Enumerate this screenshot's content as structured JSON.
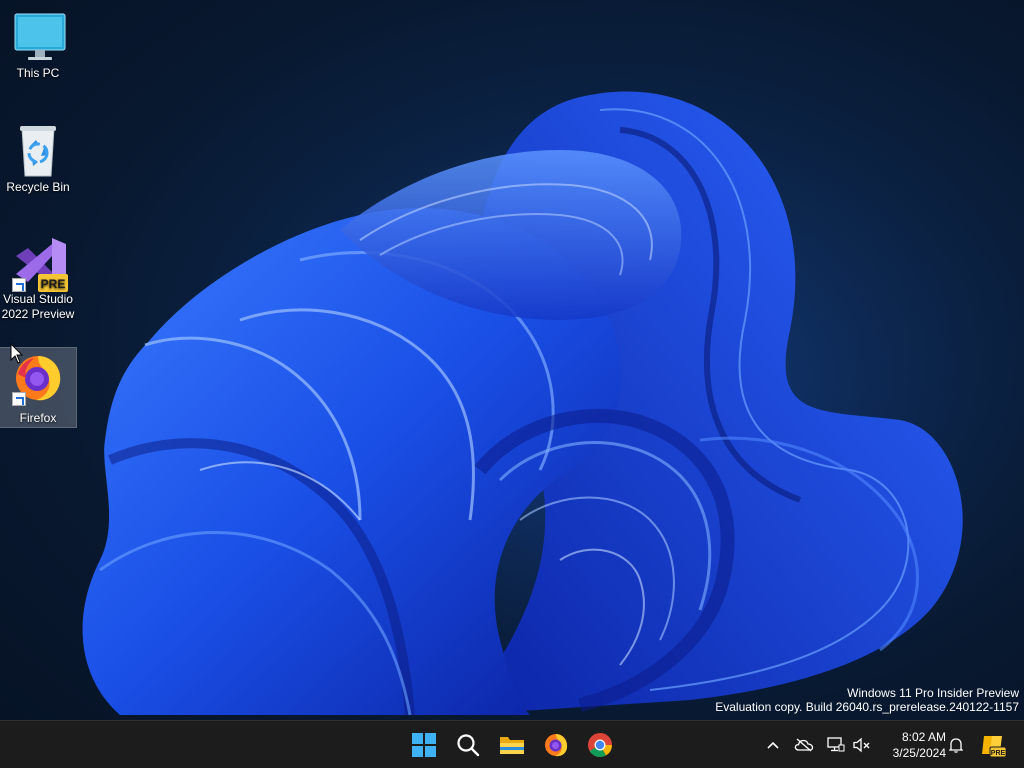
{
  "desktop": {
    "icons": [
      {
        "label": "This PC",
        "icon": "computer-icon"
      },
      {
        "label": "Recycle Bin",
        "icon": "recycle-bin-icon"
      },
      {
        "label": "Visual Studio 2022 Preview",
        "label_line1": "Visual Studio",
        "label_line2": "2022 Preview",
        "icon": "visual-studio-icon",
        "badge": "PRE",
        "shortcut": true
      },
      {
        "label": "Firefox",
        "icon": "firefox-icon",
        "shortcut": true,
        "selected": true
      }
    ]
  },
  "watermark": {
    "line1": "Windows 11 Pro Insider Preview",
    "line2": "Evaluation copy. Build 26040.rs_prerelease.240122-1157"
  },
  "taskbar": {
    "pinned": [
      "start-icon",
      "search-icon",
      "file-explorer-icon",
      "firefox-icon",
      "chrome-icon"
    ],
    "tray": [
      "chevron-up-icon",
      "onedrive-offline-icon",
      "network-icon",
      "volume-muted-icon"
    ],
    "time": "8:02 AM",
    "date": "3/25/2024",
    "badge": "PRE"
  },
  "colors": {
    "taskbar": "#1c1c1c",
    "wallpaper_bg": "#0b2346",
    "bloom": "#1d4fe0"
  }
}
